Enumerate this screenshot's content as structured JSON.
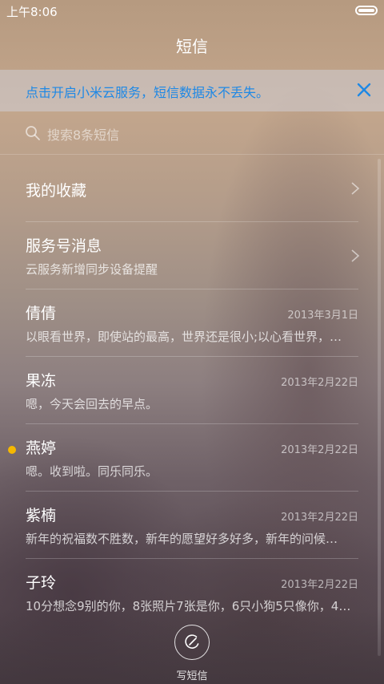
{
  "status_bar": {
    "time": "上午8:06",
    "battery_icon": "battery-icon"
  },
  "header": {
    "title": "短信"
  },
  "banner": {
    "text": "点击开启小米云服务，短信数据永不丢失。",
    "close_icon": "close-icon",
    "accent_color": "#1e88e5"
  },
  "search": {
    "placeholder": "搜索8条短信",
    "icon": "search-icon"
  },
  "list": {
    "items": [
      {
        "name": "我的收藏",
        "preview": "",
        "date": "",
        "chevron": true,
        "unread": false
      },
      {
        "name": "服务号消息",
        "preview": "云服务新增同步设备提醒",
        "date": "",
        "chevron": true,
        "unread": false
      },
      {
        "name": "倩倩",
        "preview": "以眼看世界，即使站的最高，世界还是很小;以心看世界，…",
        "date": "2013年3月1日",
        "chevron": false,
        "unread": false
      },
      {
        "name": "果冻",
        "preview": "嗯，今天会回去的早点。",
        "date": "2013年2月22日",
        "chevron": false,
        "unread": false
      },
      {
        "name": "燕婷",
        "preview": "嗯。收到啦。同乐同乐。",
        "date": "2013年2月22日",
        "chevron": false,
        "unread": true
      },
      {
        "name": "紫楠",
        "preview": "新年的祝福数不胜数，新年的愿望好多好多，新年的问候…",
        "date": "2013年2月22日",
        "chevron": false,
        "unread": false
      },
      {
        "name": "子玲",
        "preview": "10分想念9别的你，8张照片7张是你，6只小狗5只像你，4…",
        "date": "2013年2月22日",
        "chevron": false,
        "unread": false
      }
    ],
    "unread_color": "#f5b800"
  },
  "compose": {
    "label": "写短信",
    "icon": "compose-icon"
  }
}
